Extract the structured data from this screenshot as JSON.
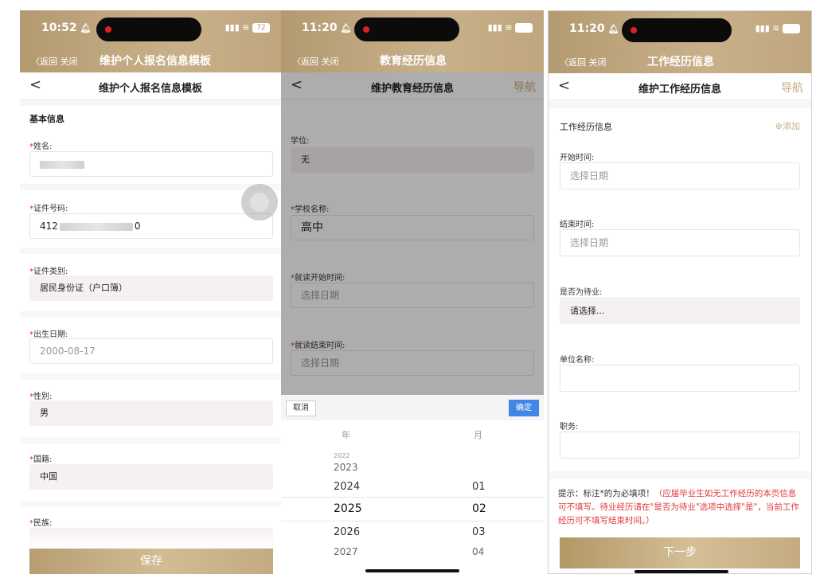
{
  "screens": [
    {
      "status": {
        "time": "10:52",
        "battery": "72"
      },
      "app_bar": {
        "back": "〈返回",
        "close": "关闭",
        "title": "维护个人报名信息模板"
      },
      "nav": {
        "back": "<",
        "title": "维护个人报名信息模板"
      },
      "section": "基本信息",
      "fields": [
        {
          "required": "*",
          "label": "姓名:",
          "value": ""
        },
        {
          "required": "*",
          "label": "证件号码:",
          "value_prefix": "412",
          "value_suffix": "0"
        },
        {
          "required": "*",
          "label": "证件类别:",
          "value": "居民身份证（户口簿）"
        },
        {
          "required": "*",
          "label": "出生日期:",
          "value": "2000-08-17"
        },
        {
          "required": "*",
          "label": "性别:",
          "value": "男"
        },
        {
          "required": "*",
          "label": "国籍:",
          "value": "中国"
        },
        {
          "required": "*",
          "label": "民族:",
          "value": ""
        }
      ],
      "save_button": "保存"
    },
    {
      "status": {
        "time": "11:20"
      },
      "app_bar": {
        "back": "〈返回",
        "close": "关闭",
        "title": "教育经历信息"
      },
      "nav": {
        "back": "<",
        "title": "维护教育经历信息",
        "right": "导航"
      },
      "fields": [
        {
          "required": "",
          "label": "学位:",
          "value": "无"
        },
        {
          "required": "*",
          "label": "学校名称:",
          "value": "高中"
        },
        {
          "required": "*",
          "label": "就读开始时间:",
          "placeholder": "选择日期"
        },
        {
          "required": "*",
          "label": "就读结束时间:",
          "placeholder": "选择日期"
        }
      ],
      "picker": {
        "cancel": "取消",
        "confirm": "确定",
        "year_header": "年",
        "month_header": "月",
        "years": [
          "2022",
          "2023",
          "2024",
          "2025",
          "2026",
          "2027"
        ],
        "months": [
          "01",
          "02",
          "03",
          "04"
        ],
        "selected_year": "2025",
        "selected_month": "02"
      }
    },
    {
      "status": {
        "time": "11:20"
      },
      "app_bar": {
        "back": "〈返回",
        "close": "关闭",
        "title": "工作经历信息"
      },
      "nav": {
        "back": "<",
        "title": "维护工作经历信息",
        "right": "导航"
      },
      "section": "工作经历信息",
      "add": "⊕添加",
      "fields": [
        {
          "label": "开始时间:",
          "placeholder": "选择日期"
        },
        {
          "label": "结束时间:",
          "placeholder": "选择日期"
        },
        {
          "label": "是否为待业:",
          "value": "请选择..."
        },
        {
          "label": "单位名称:",
          "value": ""
        },
        {
          "label": "职务:",
          "value": ""
        }
      ],
      "hint_prefix": "提示：标注*的为必填项！",
      "hint_body": "（应届毕业生如无工作经历的本页信息可不填写。待业经历请在\"是否为待业\"选项中选择\"是\"，当前工作经历可不填写结束时间。）",
      "next_button": "下一步"
    }
  ],
  "colors": {
    "gold": "#c3a97f",
    "required": "#e02d2d",
    "confirm_blue": "#3f86e6"
  }
}
